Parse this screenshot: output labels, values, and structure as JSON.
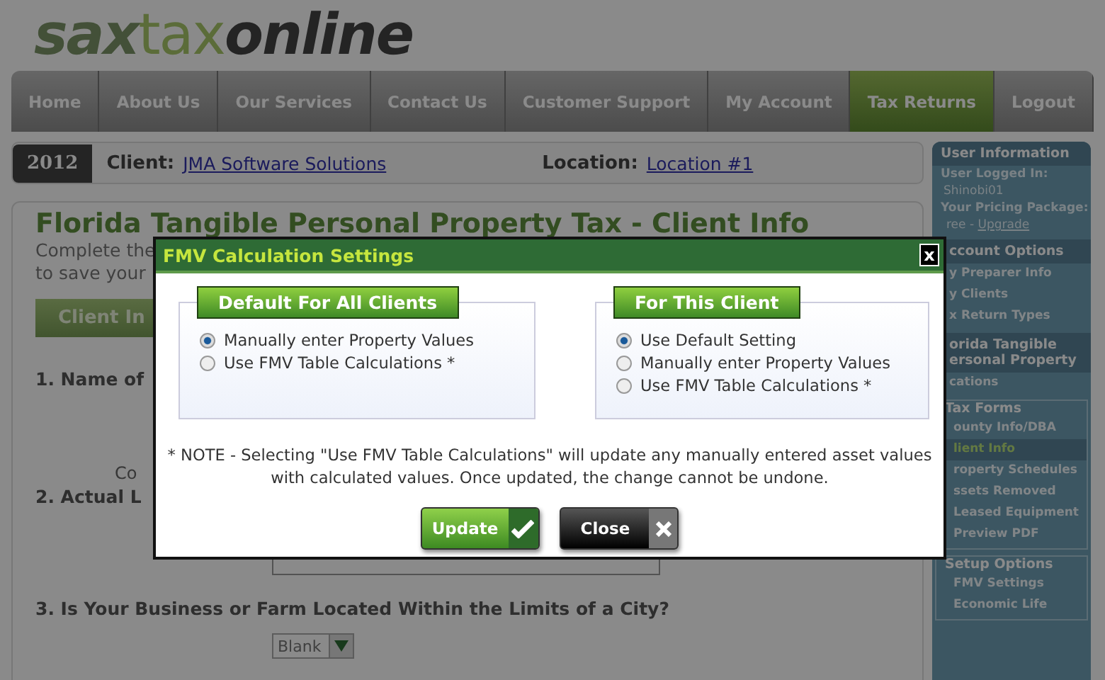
{
  "logo": {
    "part1": "sax",
    "part2": "tax",
    "part3": "online"
  },
  "nav": [
    {
      "label": "Home",
      "selected": false
    },
    {
      "label": "About Us",
      "selected": false
    },
    {
      "label": "Our Services",
      "selected": false
    },
    {
      "label": "Contact Us",
      "selected": false
    },
    {
      "label": "Customer Support",
      "selected": false
    },
    {
      "label": "My Account",
      "selected": false
    },
    {
      "label": "Tax Returns",
      "selected": true
    },
    {
      "label": "Logout",
      "selected": false
    }
  ],
  "client_bar": {
    "year": "2012",
    "client_label": "Client:",
    "client": "JMA Software Solutions",
    "location_label": "Location:",
    "location": "Location #1"
  },
  "page": {
    "title": "Florida Tangible Personal Property Tax - Client Info",
    "intro": [
      "Complete the",
      "to save your"
    ],
    "tab": "Client In",
    "q1": "1. Name of",
    "q1_sub": "Co",
    "q2": "2. Actual L",
    "q3": "3. Is Your Business or Farm Located Within the Limits of a City?",
    "select": "Blank"
  },
  "sidebar": {
    "user_heading": "User Information",
    "user_lines": [
      {
        "kind": "label",
        "text": "User Logged In:"
      },
      {
        "kind": "value",
        "text": "Shinobi01"
      },
      {
        "kind": "label",
        "text": "Your Pricing Package:"
      }
    ],
    "package": "ree - ",
    "upgrade": "Upgrade",
    "sections": [
      {
        "kind": "heading",
        "title": "ccount Options",
        "items": [
          {
            "label": "y Preparer Info",
            "selected": false
          },
          {
            "label": "y Clients",
            "selected": false
          },
          {
            "label": "x Return Types",
            "selected": false
          }
        ]
      },
      {
        "kind": "heading",
        "title": "orida Tangible ersonal Property",
        "items": [
          {
            "label": "cations",
            "selected": false
          }
        ]
      },
      {
        "kind": "group",
        "title": "Tax Forms",
        "items": [
          {
            "label": "ounty Info/DBA",
            "selected": false
          },
          {
            "label": "lient Info",
            "selected": true
          },
          {
            "label": "roperty Schedules",
            "selected": false
          },
          {
            "label": "ssets Removed",
            "selected": false
          },
          {
            "label": "Leased Equipment",
            "selected": false
          },
          {
            "label": "Preview PDF",
            "selected": false
          }
        ]
      },
      {
        "kind": "group",
        "title": "Setup Options",
        "items": [
          {
            "label": "FMV Settings",
            "selected": false
          },
          {
            "label": "Economic Life",
            "selected": false
          }
        ]
      }
    ]
  },
  "dialog": {
    "title": "FMV Calculation Settings",
    "close": "x",
    "groups": [
      {
        "legend": "Default For All Clients",
        "options": [
          {
            "label": "Manually enter Property Values",
            "selected": true
          },
          {
            "label": "Use FMV Table Calculations *",
            "selected": false
          }
        ]
      },
      {
        "legend": "For This Client",
        "options": [
          {
            "label": "Use Default Setting",
            "selected": true
          },
          {
            "label": "Manually enter Property Values",
            "selected": false
          },
          {
            "label": "Use FMV Table Calculations *",
            "selected": false
          }
        ]
      }
    ],
    "note": "* NOTE - Selecting \"Use FMV Table Calculations\" will update any manually entered asset values with calculated values. Once updated, the change cannot be undone.",
    "buttons": [
      {
        "kind": "update",
        "label": "Update"
      },
      {
        "kind": "close",
        "label": "Close"
      }
    ]
  }
}
